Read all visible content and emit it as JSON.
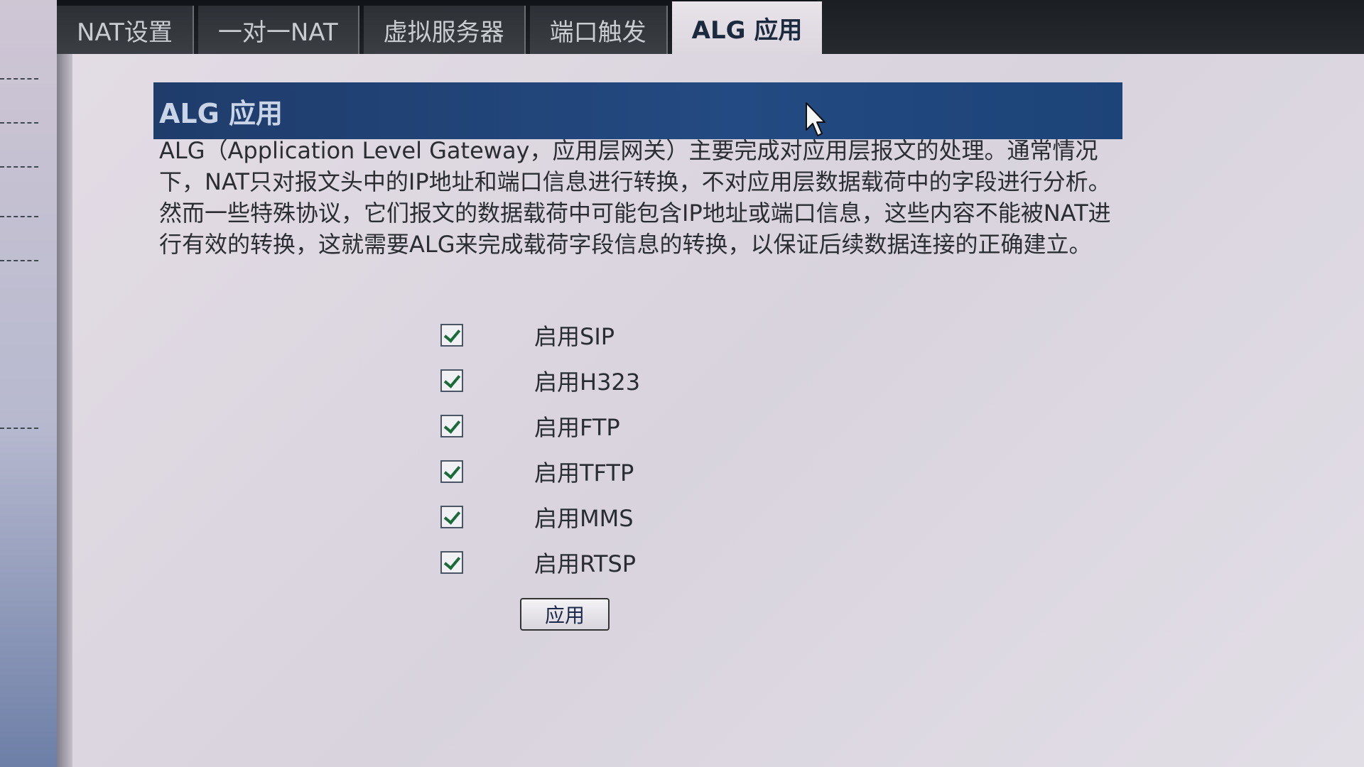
{
  "tabs": [
    {
      "label": "NAT设置",
      "active": false
    },
    {
      "label": "一对一NAT",
      "active": false
    },
    {
      "label": "虚拟服务器",
      "active": false
    },
    {
      "label": "端口触发",
      "active": false
    },
    {
      "label": "ALG 应用",
      "active": true
    }
  ],
  "section": {
    "title": "ALG 应用",
    "description": "ALG（Application Level Gateway，应用层网关）主要完成对应用层报文的处理。通常情况下，NAT只对报文头中的IP地址和端口信息进行转换，不对应用层数据载荷中的字段进行分析。然而一些特殊协议，它们报文的数据载荷中可能包含IP地址或端口信息，这些内容不能被NAT进行有效的转换，这就需要ALG来完成载荷字段信息的转换，以保证后续数据连接的正确建立。"
  },
  "options": [
    {
      "label": "启用SIP",
      "checked": true
    },
    {
      "label": "启用H323",
      "checked": true
    },
    {
      "label": "启用FTP",
      "checked": true
    },
    {
      "label": "启用TFTP",
      "checked": true
    },
    {
      "label": "启用MMS",
      "checked": true
    },
    {
      "label": "启用RTSP",
      "checked": true
    }
  ],
  "apply_label": "应用",
  "colors": {
    "header_bg": "#234a82",
    "check_tick": "#1b6b3a",
    "topbar": "#1a1e22"
  },
  "icons": {
    "checkbox": "checkmark-icon",
    "cursor": "mouse-pointer-icon"
  }
}
